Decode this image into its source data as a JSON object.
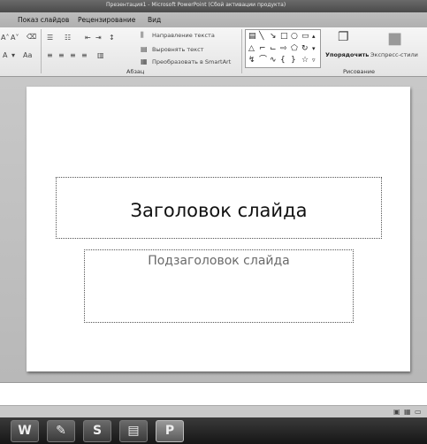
{
  "window": {
    "title": "Презентация1 - Microsoft PowerPoint (Сбой активации продукта)"
  },
  "ribbon": {
    "tabs": [
      {
        "label": "Показ слайдов"
      },
      {
        "label": "Рецензирование"
      },
      {
        "label": "Вид"
      }
    ],
    "paragraph": {
      "group_label": "Абзац",
      "text_direction": "Направление текста",
      "align_text": "Выровнять текст",
      "convert_smartart": "Преобразовать в SmartArt"
    },
    "drawing": {
      "group_label": "Рисование",
      "arrange": "Упорядочить",
      "quick_styles": "Экспресс-стили"
    }
  },
  "slide": {
    "title_placeholder": "Заголовок слайда",
    "subtitle_placeholder": "Подзаголовок слайда"
  },
  "icons": [
    "word-icon",
    "paint-icon",
    "skype-icon",
    "explorer-icon",
    "powerpoint-icon",
    "normal-view-icon",
    "slide-sorter-icon",
    "slideshow-icon"
  ]
}
